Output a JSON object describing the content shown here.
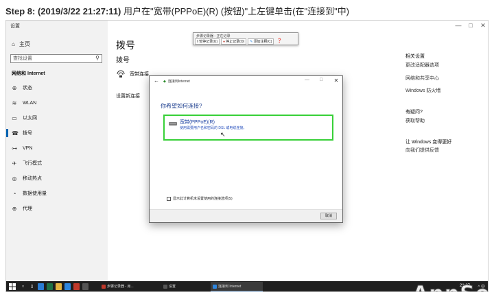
{
  "step": {
    "label": "Step 8: (2019/3/22 21:27:11)",
    "description": " 用户在\"宽带(PPPoE)(R) (按钮)\"上左键单击(在\"连接到\"中)"
  },
  "settings": {
    "window_title": "设置",
    "controls": [
      "—",
      "□",
      "✕"
    ],
    "sidebar": {
      "home": "主页",
      "search_placeholder": "查找设置",
      "section": "网络和 Internet",
      "items": [
        {
          "label": "状态",
          "icon": "globe-icon"
        },
        {
          "label": "WLAN",
          "icon": "wifi-icon"
        },
        {
          "label": "以太网",
          "icon": "ethernet-icon"
        },
        {
          "label": "拨号",
          "icon": "dialup-icon"
        },
        {
          "label": "VPN",
          "icon": "vpn-icon"
        },
        {
          "label": "飞行模式",
          "icon": "airplane-icon"
        },
        {
          "label": "移动热点",
          "icon": "hotspot-icon"
        },
        {
          "label": "数据使用量",
          "icon": "data-usage-icon"
        },
        {
          "label": "代理",
          "icon": "proxy-icon"
        }
      ],
      "active_index": 3
    },
    "main": {
      "page_title": "拨号",
      "section_title": "拨号",
      "connection_name": "宽带连接",
      "new_connection": "设置新连接"
    },
    "right_panel": {
      "related_head": "相关设置",
      "related_links": [
        "更改适配器选项",
        "网络和共享中心",
        "Windows 防火墙"
      ],
      "question_head": "有疑问?",
      "question_link": "获取帮助",
      "improve_head": "让 Windows 变得更好",
      "improve_link": "向我们提供反馈"
    }
  },
  "recorder": {
    "title": "步骤记录器 - 正在记录",
    "buttons": [
      "暂停记录(U)",
      "停止记录(O)",
      "添加注释(C)"
    ],
    "help": "❓"
  },
  "dialog": {
    "title": "连接到Internet",
    "question": "你希望如何连接?",
    "option_title": "宽带(PPPoE)(R)",
    "option_desc": "使用需要用户名和密码的 DSL 或电缆连接。",
    "checkbox_label": "显示此计算机未设置使用的连接选项(S)",
    "cancel": "取消"
  },
  "taskbar": {
    "tasks": [
      {
        "label": "步骤记录器 - 用...",
        "color": "#c0392b"
      },
      {
        "label": "设置",
        "color": "#555555"
      },
      {
        "label": "连接到 Internet",
        "color": "#2e86de"
      }
    ],
    "time": "21:27",
    "tray": "^ 中"
  },
  "watermark": "AppSo",
  "colors": {
    "highlight": "#37d037",
    "accent": "#0063b1",
    "link": "#1a3fa0"
  }
}
